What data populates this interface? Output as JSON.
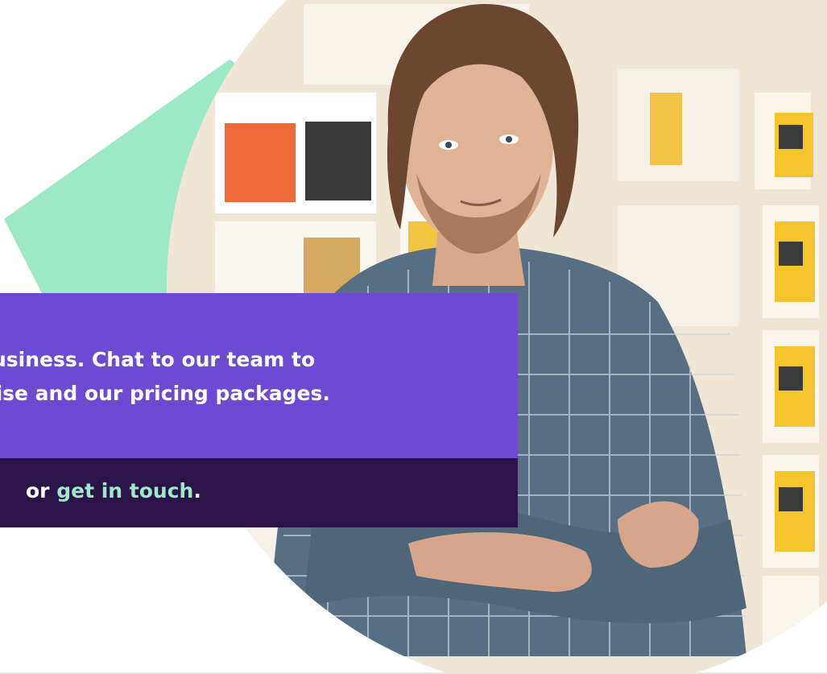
{
  "callout": {
    "line1": "usiness. Chat to our team to",
    "line2": "iise and our pricing packages.",
    "footer_prefix": "or",
    "footer_link": "get in touch",
    "footer_suffix": "."
  },
  "colors": {
    "accent_mint": "#9de8c6",
    "callout_purple": "#6c4bd2",
    "callout_dark": "#2a1448",
    "link_color": "#9de8c6"
  },
  "image": {
    "subject": "man-with-crossed-arms-photo"
  }
}
